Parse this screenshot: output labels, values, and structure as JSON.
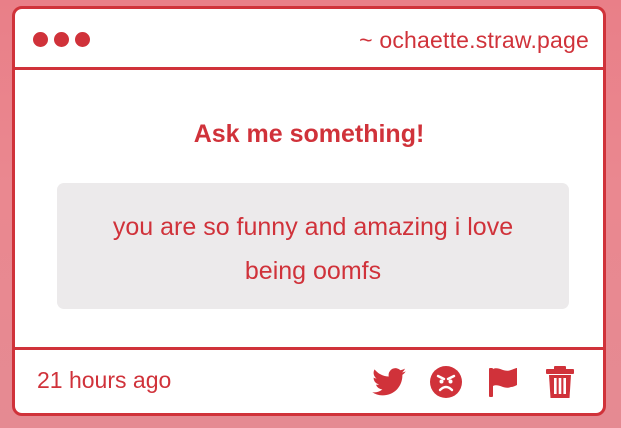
{
  "theme": {
    "accent": "#d0323a",
    "question_background": "#eceaeb",
    "page_background": "#e97f88"
  },
  "header": {
    "site_url": "~ ochaette.straw.page",
    "window_dots": [
      "dot",
      "dot",
      "dot"
    ]
  },
  "main": {
    "title": "Ask me something!",
    "question": "you are so funny and amazing i love being oomfs"
  },
  "footer": {
    "timestamp": "21 hours ago",
    "actions": [
      {
        "icon": "twitter-icon"
      },
      {
        "icon": "angry-face-icon"
      },
      {
        "icon": "flag-icon"
      },
      {
        "icon": "trash-icon"
      }
    ]
  }
}
